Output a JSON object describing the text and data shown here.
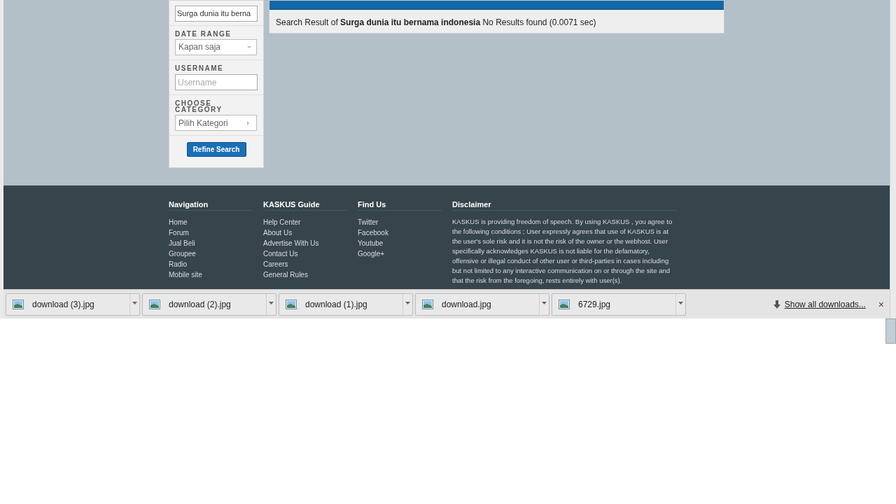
{
  "filter_sidebar": {
    "keyword_value": "Surga dunia itu berna",
    "sections": [
      {
        "kind": "select",
        "label": "DATE RANGE",
        "value": "Kapan saja"
      },
      {
        "kind": "input",
        "label": "USERNAME",
        "placeholder": "Username"
      },
      {
        "kind": "menu",
        "label": "CHOOSE CATEGORY",
        "value": "Pilih Kategori"
      }
    ],
    "button": "Refine Search"
  },
  "result": {
    "prefix": "Search Result of",
    "query": "Surga dunia itu bernama indonesia",
    "status": "No Results found (0.0071 sec)"
  },
  "footer": {
    "columns": [
      {
        "title": "Navigation",
        "links": [
          "Home",
          "Forum",
          "Jual Beli",
          "Groupee",
          "Radio",
          "Mobile site"
        ]
      },
      {
        "title": "KASKUS Guide",
        "links": [
          "Help Center",
          "About Us",
          "Advertise With Us",
          "Contact Us",
          "Careers",
          "General Rules"
        ]
      },
      {
        "title": "Find Us",
        "links": [
          "Twitter",
          "Facebook",
          "Youtube",
          "Google+"
        ]
      }
    ],
    "disclaimer": {
      "title": "Disclaimer",
      "text": "KASKUS is providing freedom of speech. By using KASKUS , you agree to the following conditions ; User expressly agrees that use of KASKUS is at the user's sole risk and it is not the risk of the owner or the webhost. User specifically acknowledges KASKUS is not liable for the defamatory, offensive or illegal conduct of other user or third-parties in cases including but not limited to any interactive communication on or through the site and that the risk from the foregoing, rests entirely with user(s)."
    }
  },
  "downloads_bar": {
    "items": [
      "download (3).jpg",
      "download (2).jpg",
      "download (1).jpg",
      "download.jpg",
      "6729.jpg"
    ],
    "show_all": "Show all downloads...",
    "close": "×"
  }
}
